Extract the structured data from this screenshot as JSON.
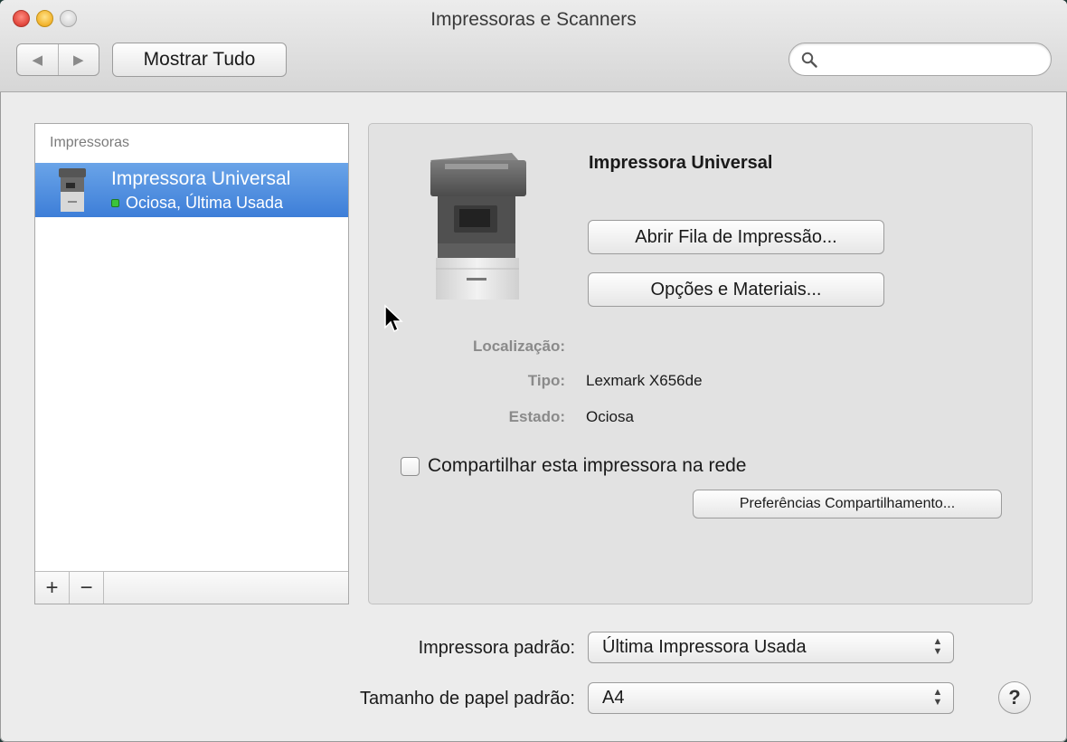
{
  "window": {
    "title": "Impressoras e Scanners"
  },
  "toolbar": {
    "back_icon": "back-arrow-icon",
    "forward_icon": "forward-arrow-icon",
    "show_all_label": "Mostrar Tudo",
    "search": {
      "placeholder": "",
      "value": "",
      "icon": "search-icon"
    }
  },
  "printer_list": {
    "header": "Impressoras",
    "items": [
      {
        "name": "Impressora Universal",
        "status": "Ociosa, Última Usada",
        "selected": true,
        "status_color": "#3bc43b"
      }
    ],
    "add_label": "+",
    "remove_label": "−"
  },
  "detail": {
    "printer_name": "Impressora Universal",
    "open_queue_label": "Abrir Fila de Impressão...",
    "options_label": "Opções e Materiais...",
    "fields": {
      "location_label": "Localização:",
      "location_value": "",
      "type_label": "Tipo:",
      "type_value": "Lexmark X656de",
      "state_label": "Estado:",
      "state_value": "Ociosa"
    },
    "share_checkbox_label": "Compartilhar esta impressora na rede",
    "share_checked": false,
    "share_prefs_label": "Preferências Compartilhamento..."
  },
  "defaults": {
    "printer_label": "Impressora padrão:",
    "printer_value": "Última Impressora Usada",
    "paper_label": "Tamanho de papel padrão:",
    "paper_value": "A4"
  },
  "help_label": "?",
  "colors": {
    "selection": "#3d7ed8",
    "status_idle": "#3bc43b"
  }
}
